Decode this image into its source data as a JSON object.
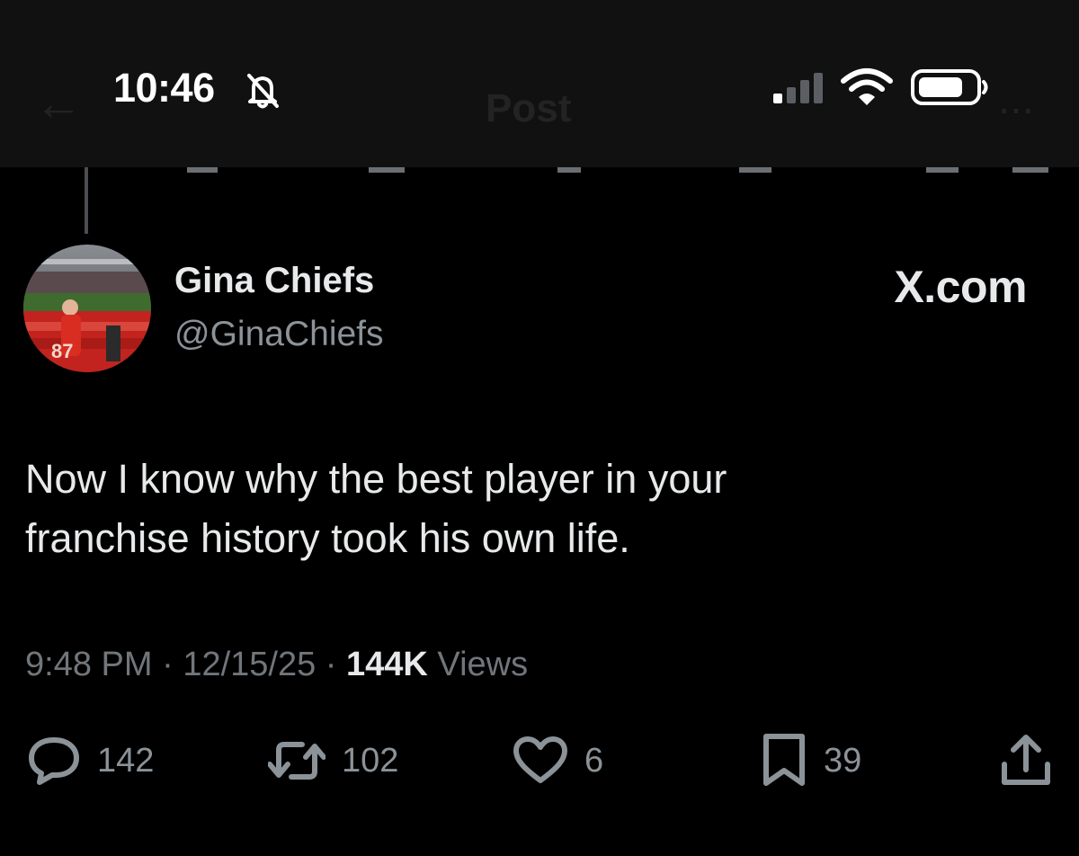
{
  "status_bar": {
    "time": "10:46",
    "icons": [
      "bell-slash-icon",
      "signal-icon",
      "wifi-icon",
      "battery-icon"
    ]
  },
  "header": {
    "title": "Post"
  },
  "tweet": {
    "author_name": "Gina Chiefs",
    "author_handle": "@GinaChiefs",
    "source": "X.com",
    "text_line1": "Now I know why the best player in your",
    "text_line2": "franchise history took his own life.",
    "time": "9:48 PM",
    "separator": "·",
    "date": "12/15/25",
    "views_count": "144K",
    "views_label": "Views"
  },
  "actions": {
    "replies": "142",
    "reposts": "102",
    "likes": "6",
    "bookmarks": "39"
  },
  "colors": {
    "background": "#000000",
    "header_background": "#111111",
    "primary_text": "#e7e9ea",
    "secondary_text": "#71767b"
  }
}
